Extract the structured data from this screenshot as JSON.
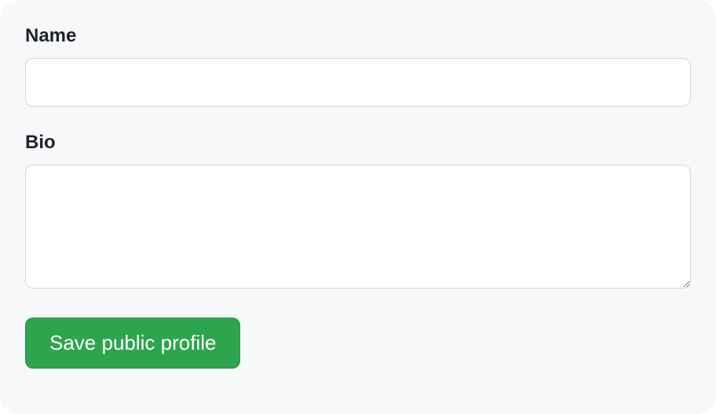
{
  "form": {
    "name": {
      "label": "Name",
      "value": ""
    },
    "bio": {
      "label": "Bio",
      "value": ""
    },
    "submit_label": "Save public profile"
  }
}
